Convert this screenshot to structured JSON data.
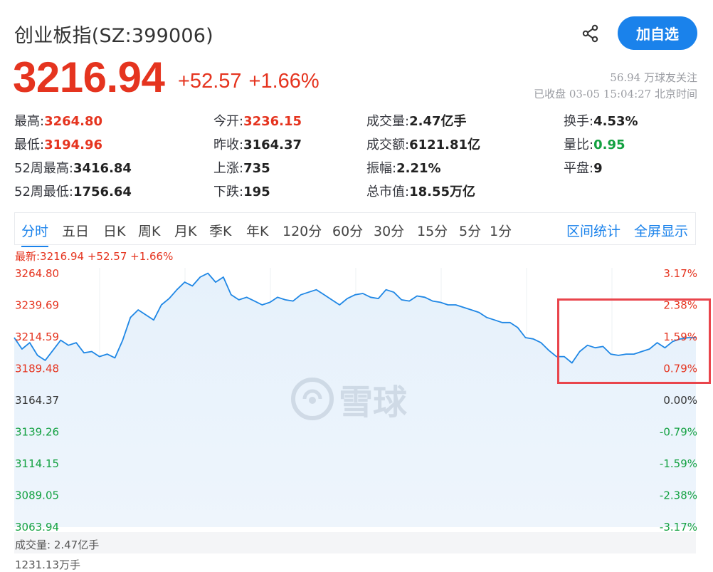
{
  "header": {
    "title": "创业板指(SZ:399006)",
    "follow_label": "加自选",
    "share_icon": "share-icon"
  },
  "price": {
    "current": "3216.94",
    "change": "+52.57",
    "change_pct": "+1.66%",
    "followers": "56.94 万球友关注",
    "status": "已收盘 03-05 15:04:27 北京时间"
  },
  "quote": {
    "high_label": "最高:",
    "high": "3264.80",
    "open_label": "今开:",
    "open": "3236.15",
    "volume_label": "成交量:",
    "volume": "2.47亿手",
    "turnover_label": "换手:",
    "turnover": "4.53%",
    "low_label": "最低:",
    "low": "3194.96",
    "prev_close_label": "昨收:",
    "prev_close": "3164.37",
    "amount_label": "成交额:",
    "amount": "6121.81亿",
    "vol_ratio_label": "量比:",
    "vol_ratio": "0.95",
    "high52_label": "52周最高:",
    "high52": "3416.84",
    "up_label": "上涨:",
    "up": "735",
    "amplitude_label": "振幅:",
    "amplitude": "2.21%",
    "flat_label": "平盘:",
    "flat": "9",
    "low52_label": "52周最低:",
    "low52": "1756.64",
    "down_label": "下跌:",
    "down": "195",
    "market_cap_label": "总市值:",
    "market_cap": "18.55万亿"
  },
  "tabs": [
    "分时",
    "五日",
    "日K",
    "周K",
    "月K",
    "季K",
    "年K",
    "120分",
    "60分",
    "30分",
    "15分",
    "5分",
    "1分"
  ],
  "active_tab": "分时",
  "tools": {
    "range_stats": "区间统计",
    "fullscreen": "全屏显示"
  },
  "latest_line": "最新:3216.94 +52.57 +1.66%",
  "watermark": "雪球",
  "volume_label": "成交量: 2.47亿手",
  "volume_max": "1231.13万手",
  "colors": {
    "up": "#e5341f",
    "down": "#13a141",
    "accent": "#1a82eb",
    "highlight": "#e9454c"
  },
  "chart_data": {
    "type": "area",
    "series": [
      {
        "values": [
          3214,
          3205,
          3210,
          3200,
          3196,
          3204,
          3212,
          3208,
          3210,
          3202,
          3203,
          3199,
          3201,
          3198,
          3212,
          3230,
          3236,
          3232,
          3228,
          3240,
          3245,
          3252,
          3258,
          3255,
          3262,
          3265,
          3258,
          3262,
          3248,
          3244,
          3246,
          3243,
          3240,
          3242,
          3246,
          3244,
          3243,
          3248,
          3250,
          3252,
          3248,
          3244,
          3240,
          3245,
          3248,
          3249,
          3246,
          3245,
          3252,
          3250,
          3244,
          3243,
          3247,
          3246,
          3243,
          3242,
          3240,
          3240,
          3238,
          3236,
          3234,
          3230,
          3228,
          3226,
          3226,
          3222,
          3214,
          3213,
          3210,
          3204,
          3199,
          3199,
          3194,
          3203,
          3208,
          3206,
          3207,
          3201,
          3200,
          3201,
          3201,
          3203,
          3205,
          3210,
          3206,
          3211,
          3213,
          3214,
          3214
        ]
      }
    ],
    "y_ticks_price": [
      "3264.80",
      "3239.69",
      "3214.59",
      "3189.48",
      "3164.37",
      "3139.26",
      "3114.15",
      "3089.05",
      "3063.94"
    ],
    "y_ticks_pct": [
      "3.17%",
      "2.38%",
      "1.59%",
      "0.79%",
      "0.00%",
      "-0.79%",
      "-1.59%",
      "-2.38%",
      "-3.17%"
    ],
    "ylim": [
      3063.94,
      3264.8
    ],
    "baseline": 3164.37,
    "grid": true
  }
}
